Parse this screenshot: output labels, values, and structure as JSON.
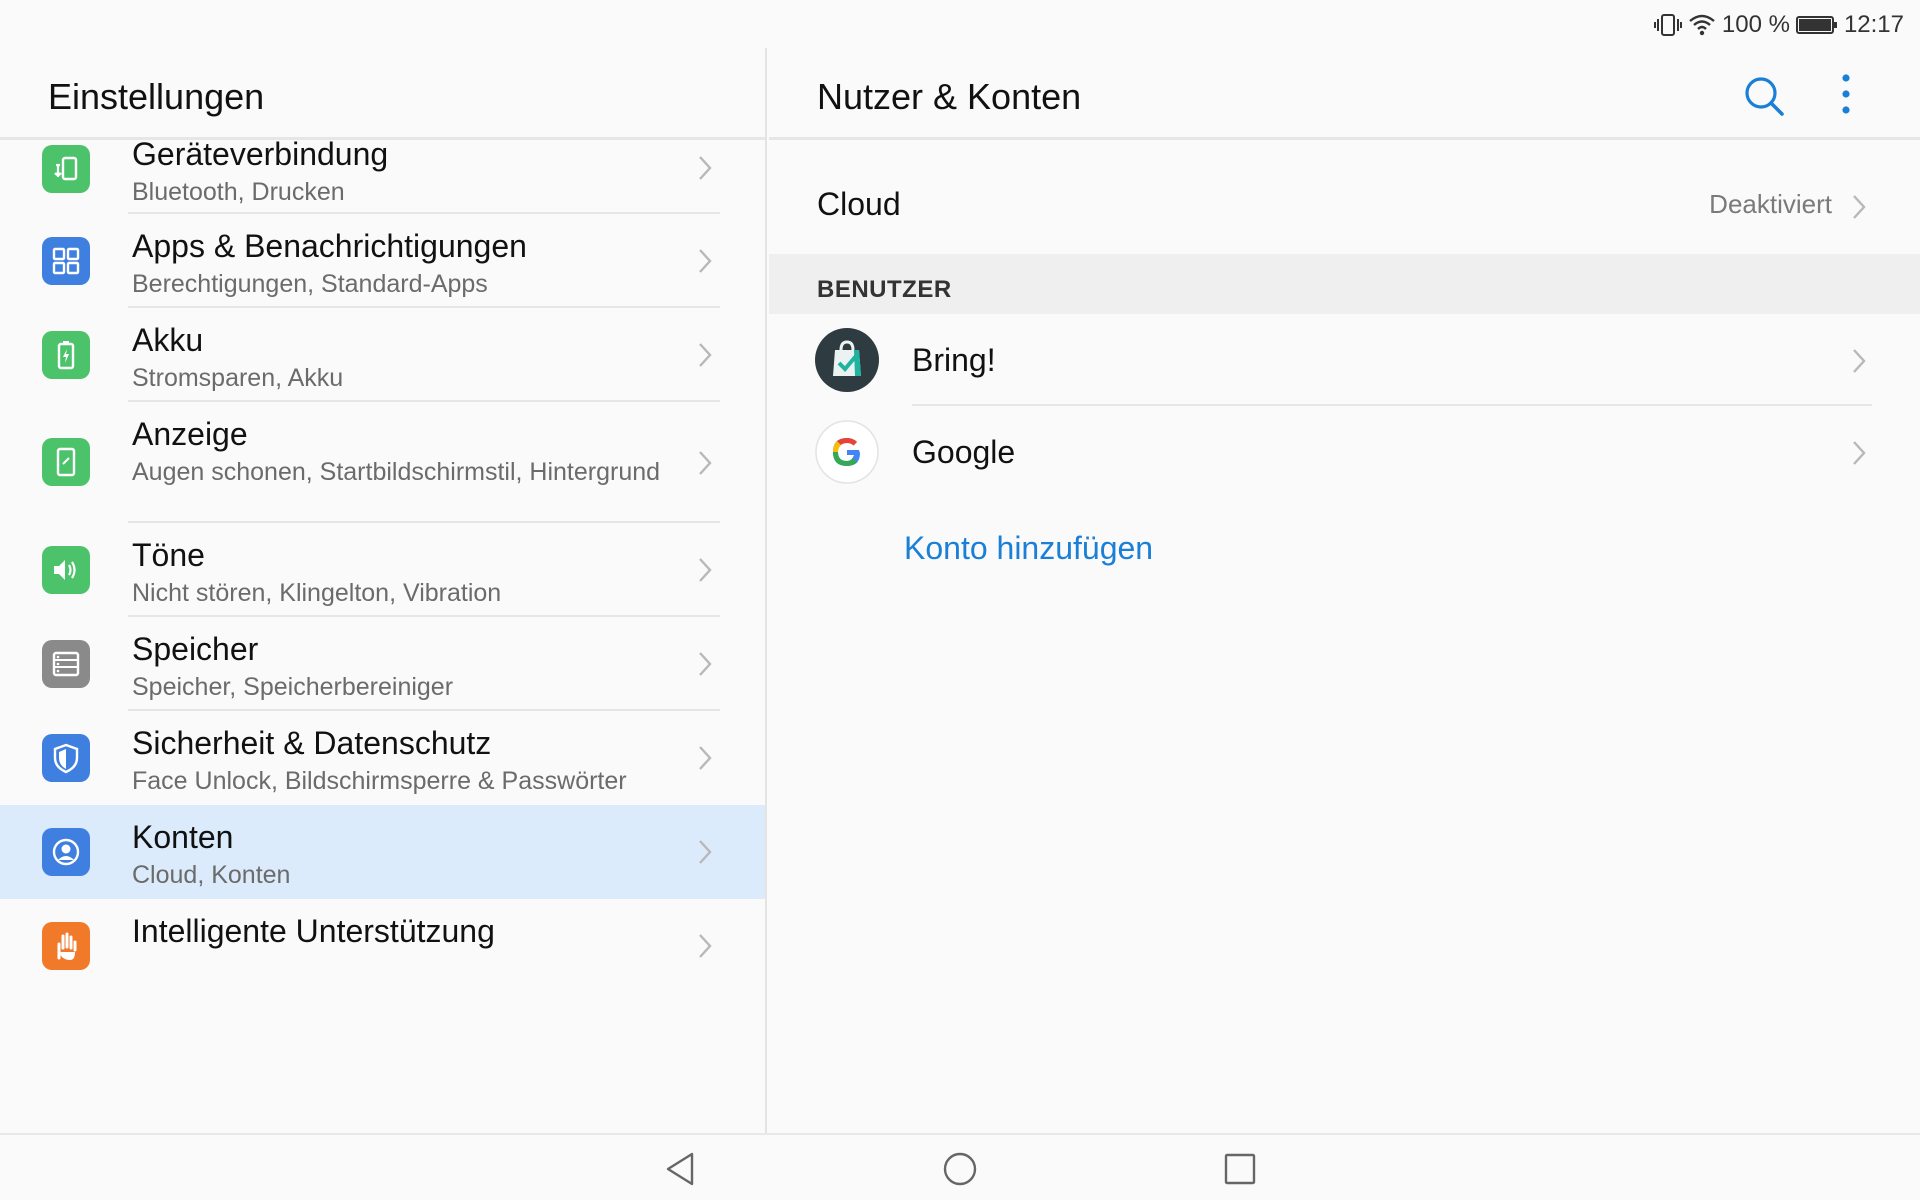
{
  "status_bar": {
    "battery_percent_label": "100 %",
    "time": "12:17",
    "battery_level": 1.0
  },
  "left_pane": {
    "title": "Einstellungen",
    "items": [
      {
        "title": "Geräteverbindung",
        "subtitle": "Bluetooth, Drucken",
        "icon": "device-connection-icon",
        "color": "#4cc36b"
      },
      {
        "title": "Apps & Benachrichtigungen",
        "subtitle": "Berechtigungen, Standard-Apps",
        "icon": "apps-grid-icon",
        "color": "#3f7fe0"
      },
      {
        "title": "Akku",
        "subtitle": "Stromsparen, Akku",
        "icon": "battery-icon",
        "color": "#4cc36b"
      },
      {
        "title": "Anzeige",
        "subtitle": "Augen schonen, Startbildschirmstil, Hintergrund",
        "icon": "display-icon",
        "color": "#4cc36b"
      },
      {
        "title": "Töne",
        "subtitle": "Nicht stören, Klingelton, Vibration",
        "icon": "speaker-icon",
        "color": "#4cc36b"
      },
      {
        "title": "Speicher",
        "subtitle": "Speicher, Speicherbereiniger",
        "icon": "storage-icon",
        "color": "#8a8a8a"
      },
      {
        "title": "Sicherheit & Datenschutz",
        "subtitle": "Face Unlock, Bildschirmsperre & Passwörter",
        "icon": "shield-icon",
        "color": "#3f7fe0"
      },
      {
        "title": "Konten",
        "subtitle": "Cloud, Konten",
        "icon": "account-icon",
        "color": "#3f7fe0"
      },
      {
        "title": "Intelligente Unterstützung",
        "subtitle": "",
        "icon": "hand-icon",
        "color": "#f07a2a"
      }
    ]
  },
  "right_pane": {
    "title": "Nutzer & Konten",
    "cloud": {
      "label": "Cloud",
      "value": "Deaktiviert"
    },
    "section_users": "BENUTZER",
    "accounts": [
      {
        "label": "Bring!",
        "icon": "bring-app-icon"
      },
      {
        "label": "Google",
        "icon": "google-logo-icon"
      }
    ],
    "add_account": "Konto hinzufügen"
  },
  "colors": {
    "accent": "#1a7fd6",
    "active_row": "#dcebfb"
  }
}
